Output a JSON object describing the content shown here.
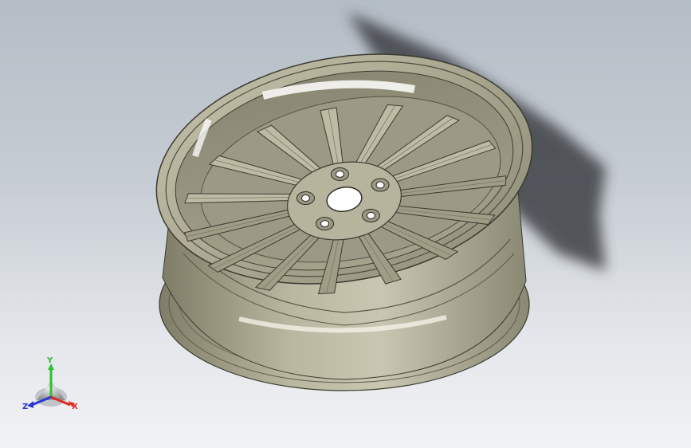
{
  "triad": {
    "x_label": "X",
    "y_label": "Y",
    "z_label": "Z",
    "x_color": "#e0281e",
    "y_color": "#2fbf2f",
    "z_color": "#2c35d8"
  },
  "model": {
    "part": "wheel-rim",
    "spoke_count": 15,
    "lug_hole_count": 5,
    "surface_color": "#b8b69c",
    "shadow_color": "#3c3f44"
  }
}
